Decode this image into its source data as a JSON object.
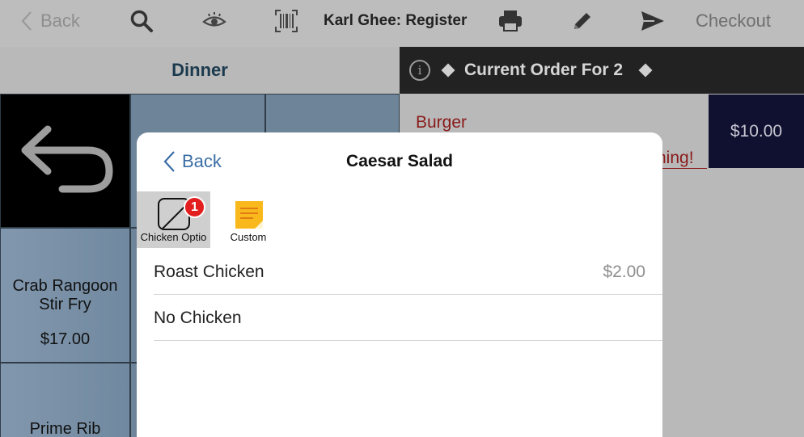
{
  "toolbar": {
    "back_label": "Back",
    "title": "Karl Ghee: Register",
    "checkout_label": "Checkout"
  },
  "menu": {
    "section_title": "Dinner",
    "items": [
      {
        "name": "Crab Rangoon Stir Fry",
        "price": "$17.00"
      },
      {
        "name": "Prime Rib",
        "price": ""
      }
    ]
  },
  "order": {
    "info_glyph": "i",
    "title": "Current Order For 2",
    "item_name": "Burger",
    "item_warning": "ning!",
    "item_price": "$10.00"
  },
  "modal": {
    "back_label": "Back",
    "title": "Caesar Salad",
    "tabs": [
      {
        "label": "Chicken Optio",
        "badge": "1",
        "icon": "chicken-options-icon"
      },
      {
        "label": "Custom",
        "icon": "sticky-note-icon"
      }
    ],
    "options": [
      {
        "label": "Roast Chicken",
        "price": "$2.00"
      },
      {
        "label": "No Chicken",
        "price": ""
      }
    ]
  },
  "colors": {
    "accent_blue": "#3a6ea5",
    "order_red": "#8a1a1a",
    "badge_red": "#e31e1e",
    "tile_blue": "#7189a0"
  }
}
